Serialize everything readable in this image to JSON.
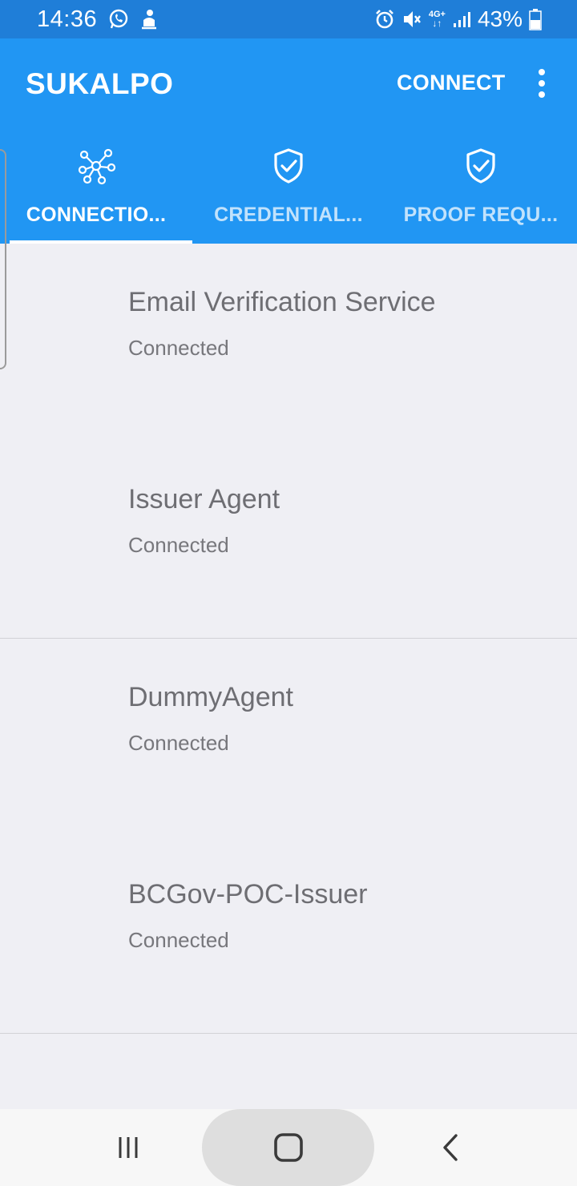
{
  "status_bar": {
    "time": "14:36",
    "battery": "43%",
    "network": "4G+",
    "icons": [
      "whatsapp-icon",
      "notification-icon",
      "alarm-icon",
      "mute-icon",
      "network-4g-icon",
      "signal-icon",
      "battery-icon"
    ]
  },
  "app_bar": {
    "title": "SUKALPO",
    "connect_label": "CONNECT",
    "more_icon": "more-vert-icon",
    "color": "#2196f3"
  },
  "tabs": [
    {
      "label": "CONNECTIO...",
      "icon": "network-nodes-icon",
      "active": true
    },
    {
      "label": "CREDENTIAL...",
      "icon": "shield-check-icon",
      "active": false
    },
    {
      "label": "PROOF REQU...",
      "icon": "shield-check-icon",
      "active": false
    }
  ],
  "connections": [
    {
      "name": "Email Verification Service",
      "status": "Connected"
    },
    {
      "name": "Issuer Agent",
      "status": "Connected"
    },
    {
      "name": "DummyAgent",
      "status": "Connected"
    },
    {
      "name": "BCGov-POC-Issuer",
      "status": "Connected"
    }
  ],
  "nav_bar": {
    "recents_icon": "recents-icon",
    "home_icon": "home-icon",
    "back_icon": "back-icon"
  }
}
